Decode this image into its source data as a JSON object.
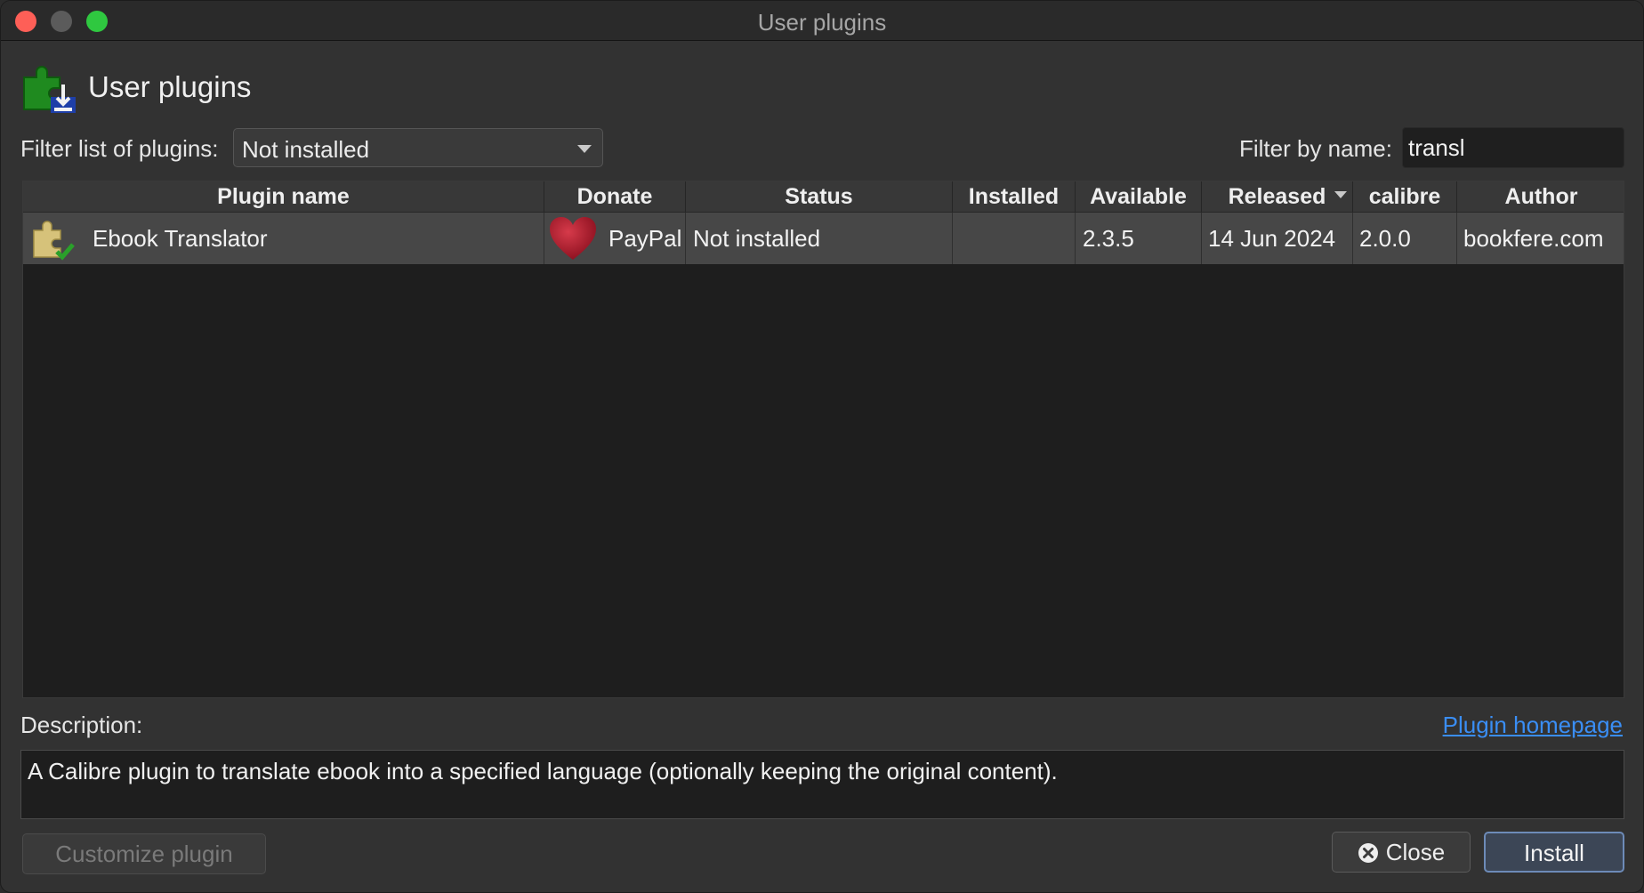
{
  "window": {
    "title": "User plugins"
  },
  "header": {
    "title": "User plugins",
    "icon": "puzzle-download-icon"
  },
  "filter": {
    "label": "Filter list of plugins:",
    "selected": "Not installed",
    "name_label": "Filter by name:",
    "name_value": "transl"
  },
  "table": {
    "columns": [
      "Plugin name",
      "Donate",
      "Status",
      "Installed",
      "Available",
      "Released",
      "calibre",
      "Author"
    ],
    "sorted_column": "Released",
    "rows": [
      {
        "name": "Ebook Translator",
        "donate": "PayPal",
        "status": "Not installed",
        "installed": "",
        "available": "2.3.5",
        "released": "14 Jun 2024",
        "calibre": "2.0.0",
        "author": "bookfere.com"
      }
    ]
  },
  "description": {
    "label": "Description:",
    "homepage_link": "Plugin homepage",
    "text": "A Calibre plugin to translate ebook into a specified language (optionally keeping the original content)."
  },
  "buttons": {
    "customize": "Customize plugin",
    "close": "Close",
    "install": "Install"
  },
  "colors": {
    "link": "#3a8ef5",
    "selected_row": "#474747",
    "default_button_border": "#6d8bb8"
  }
}
